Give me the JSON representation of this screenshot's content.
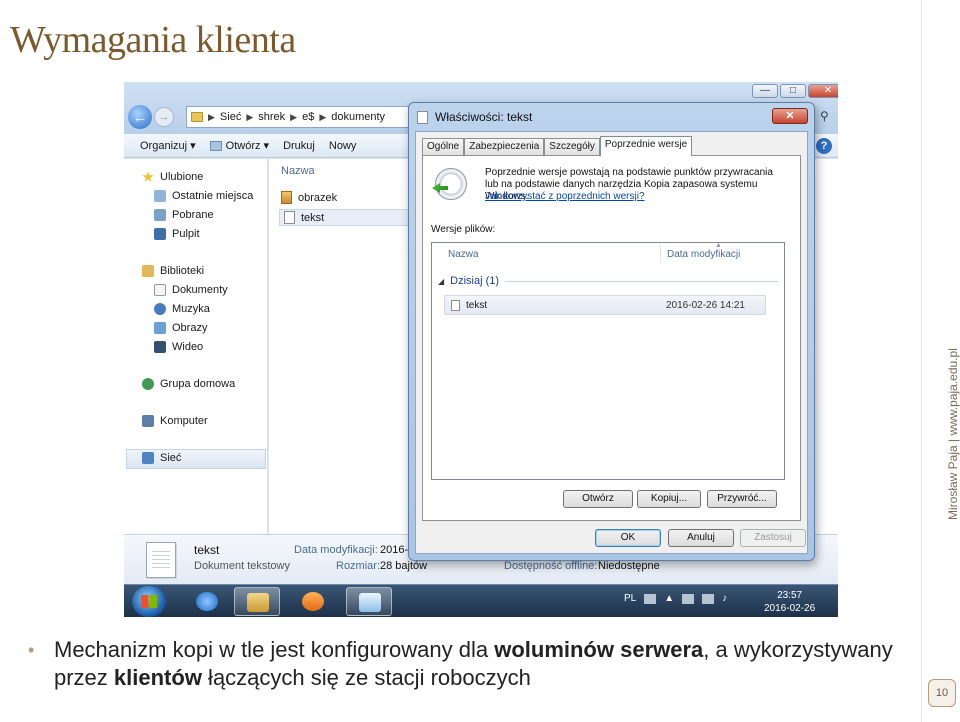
{
  "slide": {
    "title": "Wymagania klienta",
    "side_text": "Mirosław Paja | www.paja.edu.pl",
    "page_number": "10",
    "bullet": {
      "p1": "Mechanizm kopi w tle jest konfigurowany dla ",
      "b1": "woluminów serwera",
      "p2": ", a wykorzystywany przez ",
      "b2": "klientów",
      "p3": " łączących się ze stacji roboczych"
    }
  },
  "explorer": {
    "window_controls": {
      "minimize": "—",
      "maximize": "□",
      "close": "✕"
    },
    "address": {
      "root": "Sieć",
      "host": "shrek",
      "share": "e$",
      "folder": "dokumenty"
    },
    "toolbar": {
      "organize": "Organizuj ▾",
      "open": "Otwórz ▾",
      "print": "Drukuj",
      "new": "Nowy"
    },
    "nav": {
      "favorites": "Ulubione",
      "recent": "Ostatnie miejsca",
      "downloads": "Pobrane",
      "desktop": "Pulpit",
      "libraries": "Biblioteki",
      "documents": "Dokumenty",
      "music": "Muzyka",
      "pictures": "Obrazy",
      "videos": "Wideo",
      "homegroup": "Grupa domowa",
      "computer": "Komputer",
      "network": "Sieć"
    },
    "file_list": {
      "column": "Nazwa",
      "files": [
        "obrazek",
        "tekst"
      ]
    },
    "details": {
      "name": "tekst",
      "type": "Dokument tekstowy",
      "modified_label": "Data modyfikacji:",
      "modified_value": "2016-0",
      "size_label": "Rozmiar:",
      "size_value": "28 bajtów",
      "offline_label": "Dostępność offline:",
      "offline_value": "Niedostępne"
    }
  },
  "taskbar": {
    "lang": "PL",
    "time": "23:57",
    "date": "2016-02-26"
  },
  "dialog": {
    "title": "Właściwości: tekst",
    "close": "✕",
    "tabs": [
      "Ogólne",
      "Zabezpieczenia",
      "Szczegóły",
      "Poprzednie wersje"
    ],
    "info": "Poprzednie wersje powstają na podstawie punktów przywracania lub na podstawie danych narzędzia Kopia zapasowa systemu Windows.",
    "link": "Jak korzystać z poprzednich wersji?",
    "versions_label": "Wersje plików:",
    "list": {
      "col_name": "Nazwa",
      "col_date": "Data modyfikacji",
      "group": "Dzisiaj (1)",
      "row_name": "tekst",
      "row_date": "2016-02-26 14:21"
    },
    "buttons": {
      "open": "Otwórz",
      "copy": "Kopiuj...",
      "restore": "Przywróć...",
      "ok": "OK",
      "cancel": "Anuluj",
      "apply": "Zastosuj"
    }
  }
}
